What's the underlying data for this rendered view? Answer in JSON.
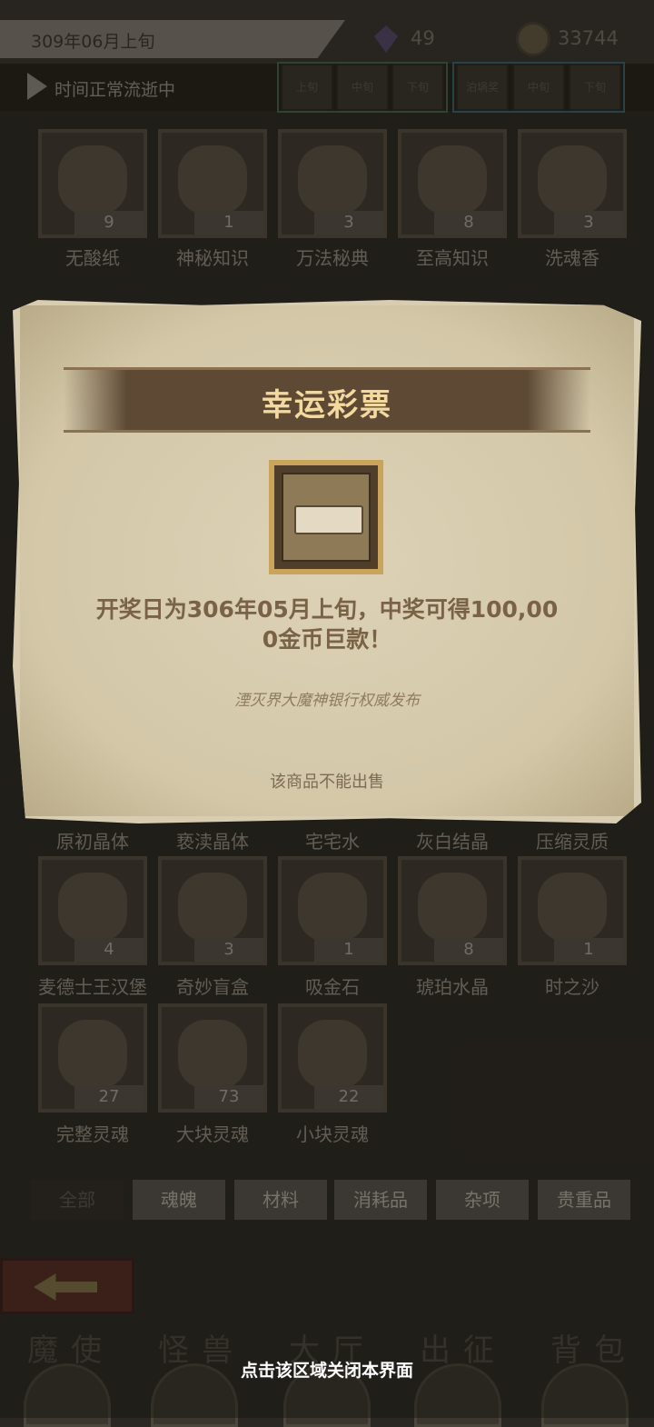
{
  "header": {
    "date": "309年06月上旬",
    "gems": "49",
    "coins": "33744",
    "time_status": "时间正常流逝中",
    "periods_a": [
      "上旬",
      "中旬",
      "下旬"
    ],
    "periods_b": [
      "泊埚奖",
      "中旬",
      "下旬"
    ]
  },
  "items_row1": [
    {
      "name": "无酸纸",
      "qty": "9"
    },
    {
      "name": "神秘知识",
      "qty": "1"
    },
    {
      "name": "万法秘典",
      "qty": "3"
    },
    {
      "name": "至高知识",
      "qty": "8"
    },
    {
      "name": "洗魂香",
      "qty": "3"
    }
  ],
  "items_row3_names": [
    "原初晶体",
    "亵渎晶体",
    "宅宅水",
    "灰白结晶",
    "压缩灵质"
  ],
  "items_row4": [
    {
      "name": "麦德士王汉堡",
      "qty": "4"
    },
    {
      "name": "奇妙盲盒",
      "qty": "3"
    },
    {
      "name": "吸金石",
      "qty": "1"
    },
    {
      "name": "琥珀水晶",
      "qty": "8"
    },
    {
      "name": "时之沙",
      "qty": "1"
    }
  ],
  "items_row5": [
    {
      "name": "完整灵魂",
      "qty": "27"
    },
    {
      "name": "大块灵魂",
      "qty": "73"
    },
    {
      "name": "小块灵魂",
      "qty": "22"
    }
  ],
  "tabs": [
    "全部",
    "魂魄",
    "材料",
    "消耗品",
    "杂项",
    "贵重品"
  ],
  "nav": [
    "魔使",
    "怪兽",
    "大厅",
    "出征",
    "背包"
  ],
  "dialog": {
    "title": "幸运彩票",
    "description_line1": "开奖日为306年05月上旬，中奖可得100,00",
    "description_line2": "0金币巨款！",
    "source": "湮灭界大魔神银行权威发布",
    "no_sell": "该商品不能出售"
  },
  "close_hint": "点击该区域关闭本界面",
  "colors": {
    "dialog_paper": "#d8cdb0",
    "banner": "#5e4a34",
    "title_text": "#f3d9a0",
    "frame_gold": "#c9a45a"
  }
}
